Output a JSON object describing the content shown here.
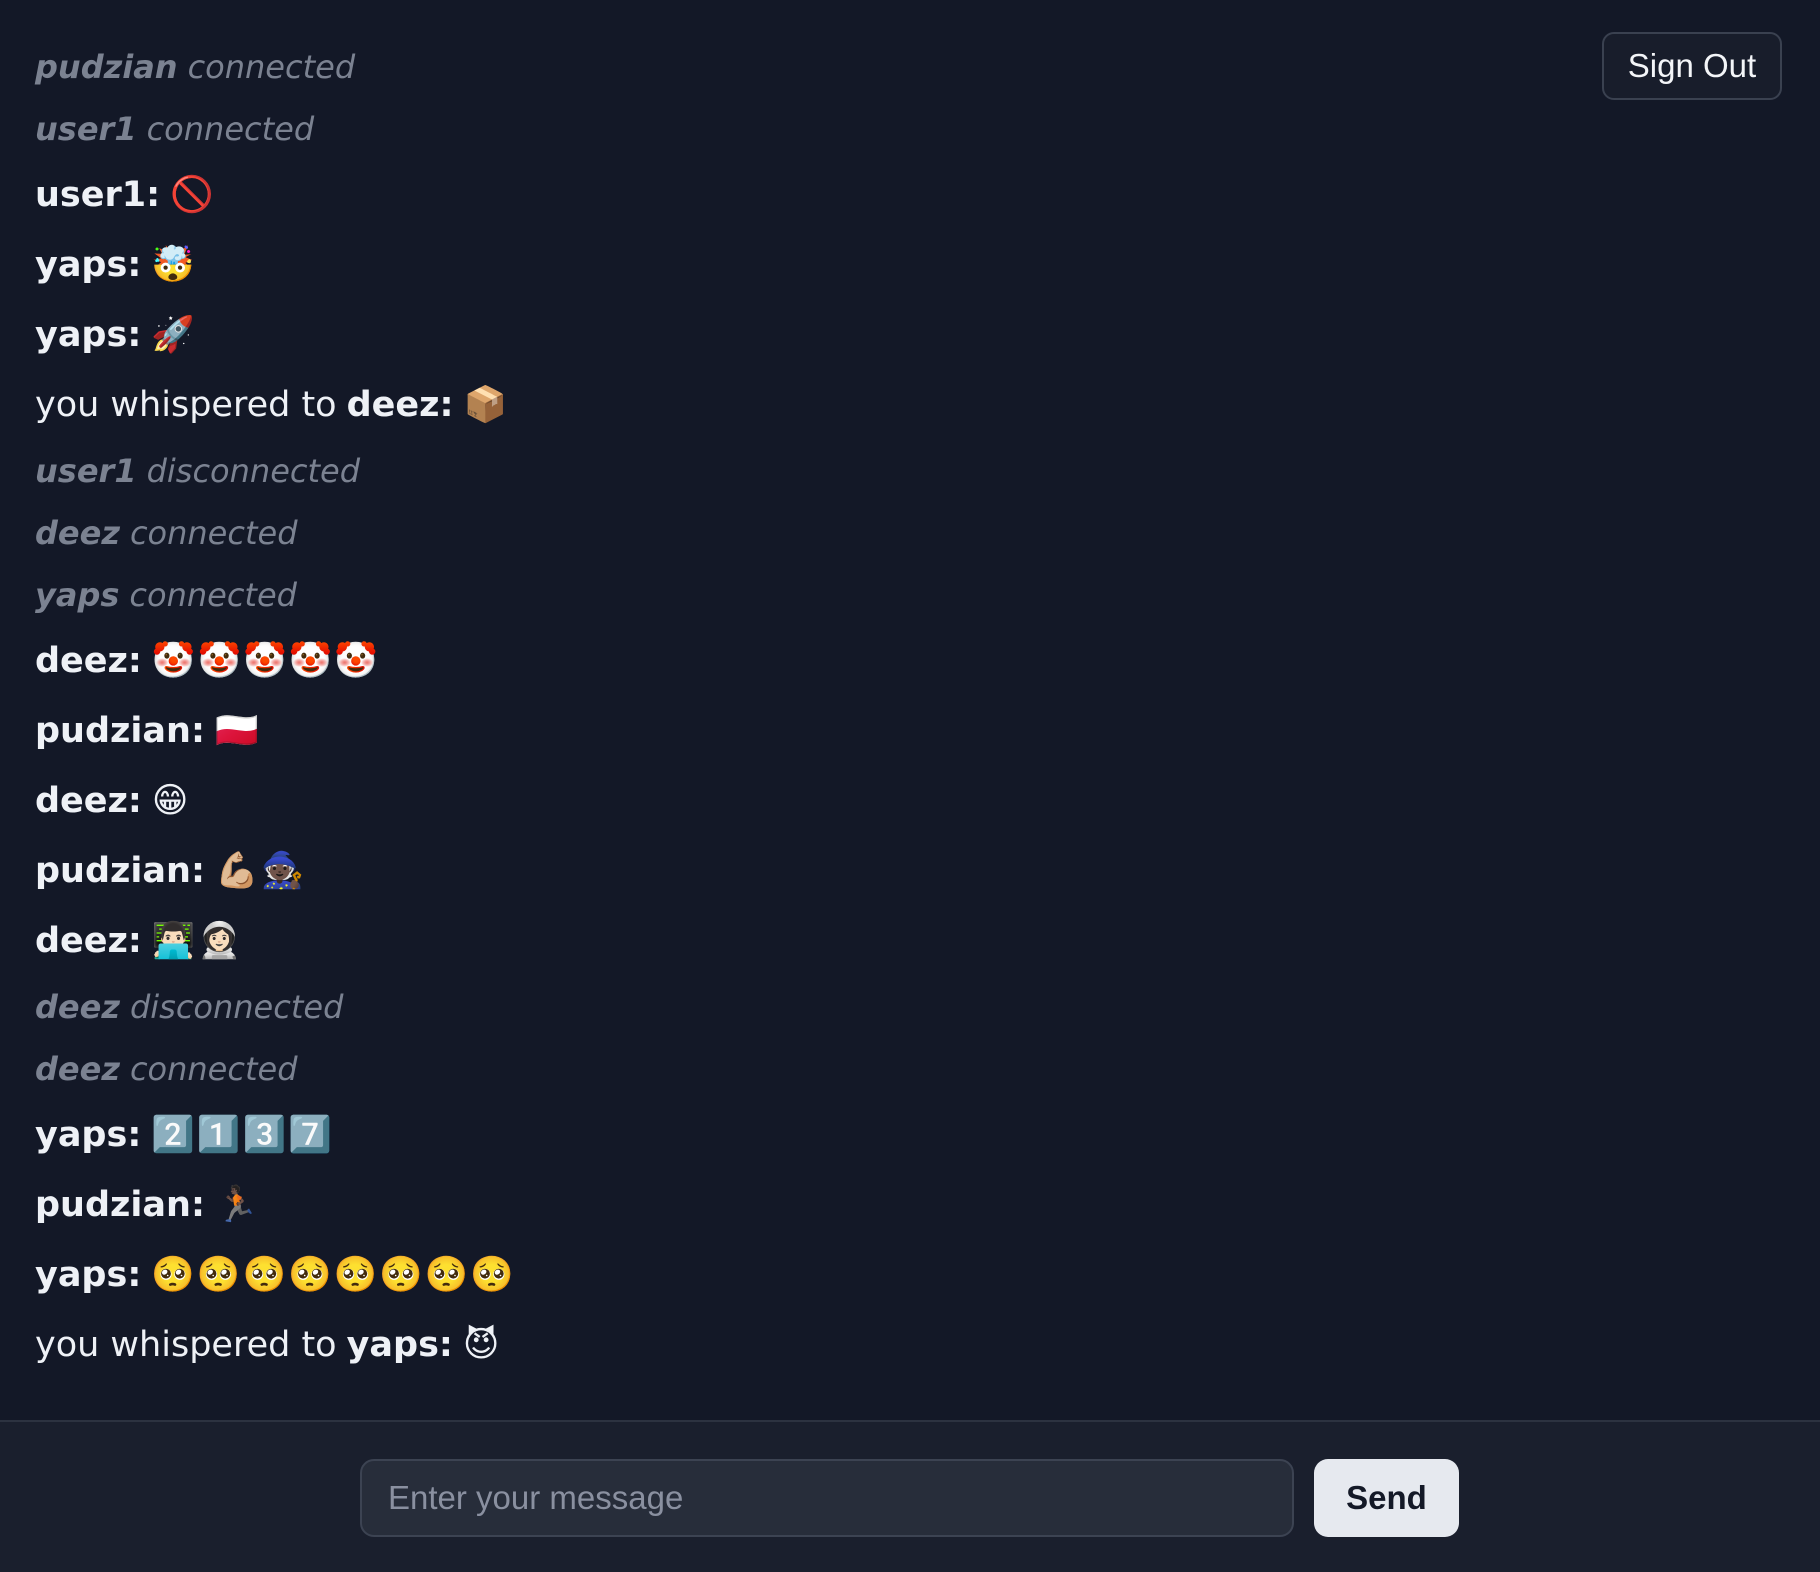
{
  "header": {
    "sign_out_label": "Sign Out"
  },
  "messages": [
    {
      "type": "status",
      "user": "pudzian",
      "text": "connected"
    },
    {
      "type": "status",
      "user": "user1",
      "text": "connected"
    },
    {
      "type": "chat",
      "user": "user1",
      "text": "🚫"
    },
    {
      "type": "chat",
      "user": "yaps",
      "text": "🤯"
    },
    {
      "type": "chat",
      "user": "yaps",
      "text": "🚀"
    },
    {
      "type": "whisper",
      "prefix": "you whispered to",
      "user": "deez",
      "text": "📦"
    },
    {
      "type": "status",
      "user": "user1",
      "text": "disconnected"
    },
    {
      "type": "status",
      "user": "deez",
      "text": "connected"
    },
    {
      "type": "status",
      "user": "yaps",
      "text": "connected"
    },
    {
      "type": "chat",
      "user": "deez",
      "text": "🤡🤡🤡🤡🤡"
    },
    {
      "type": "chat",
      "user": "pudzian",
      "text": "🇵🇱"
    },
    {
      "type": "chat",
      "user": "deez",
      "text": "😁"
    },
    {
      "type": "chat",
      "user": "pudzian",
      "text": "💪🏼🧙🏿"
    },
    {
      "type": "chat",
      "user": "deez",
      "text": "👨🏻‍💻👩🏻‍🚀"
    },
    {
      "type": "status",
      "user": "deez",
      "text": "disconnected"
    },
    {
      "type": "status",
      "user": "deez",
      "text": "connected"
    },
    {
      "type": "chat",
      "user": "yaps",
      "text": "2️⃣1️⃣3️⃣7️⃣"
    },
    {
      "type": "chat",
      "user": "pudzian",
      "text": "🏃🏿"
    },
    {
      "type": "chat",
      "user": "yaps",
      "text": "🥺🥺🥺🥺🥺🥺🥺🥺"
    },
    {
      "type": "whisper",
      "prefix": "you whispered to",
      "user": "yaps",
      "text": "😈"
    }
  ],
  "composer": {
    "placeholder": "Enter your message",
    "value": "",
    "send_label": "Send"
  }
}
